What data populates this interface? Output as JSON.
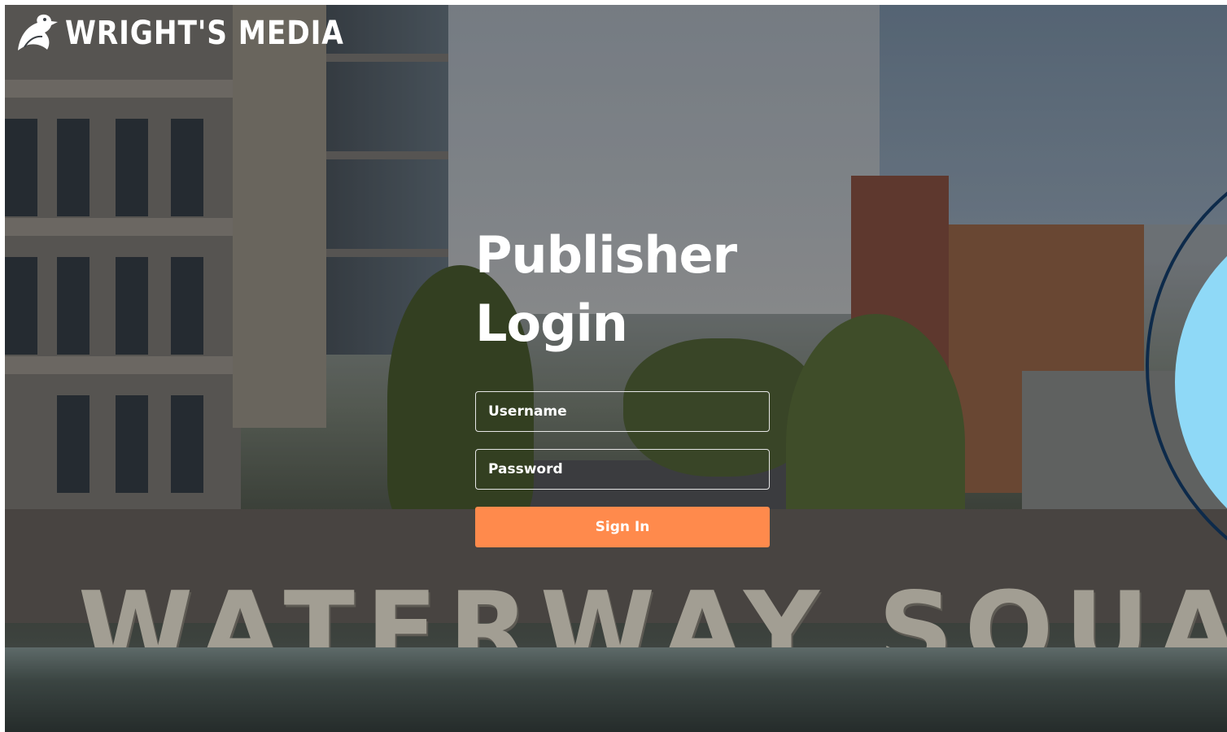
{
  "brand": {
    "name": "WRIGHT'S MEDIA",
    "logo_icon": "duck-icon",
    "text_color": "#ffffff"
  },
  "background": {
    "sign_text": "WATERWAY SQUARE"
  },
  "login": {
    "title_line1": "Publisher",
    "title_line2": "Login",
    "username_placeholder": "Username",
    "username_value": "",
    "password_placeholder": "Password",
    "password_value": "",
    "submit_label": "Sign In",
    "button_color": "#ff8a4c"
  },
  "decoration": {
    "ring_color": "#0d2a4a",
    "disc_color": "#8fd9f7"
  }
}
